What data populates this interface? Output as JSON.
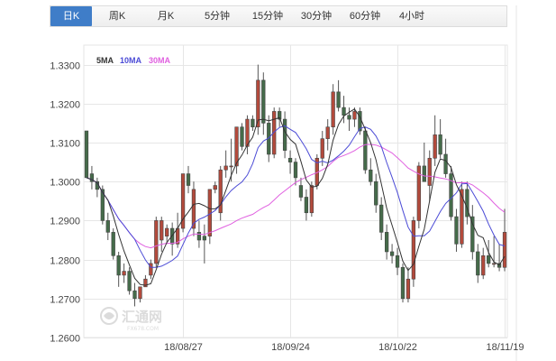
{
  "tabs": [
    {
      "label": "日K",
      "active": true
    },
    {
      "label": "周K",
      "active": false
    },
    {
      "label": "月K",
      "active": false
    },
    {
      "label": "5分钟",
      "active": false
    },
    {
      "label": "15分钟",
      "active": false
    },
    {
      "label": "30分钟",
      "active": false
    },
    {
      "label": "60分钟",
      "active": false
    },
    {
      "label": "4小时",
      "active": false
    }
  ],
  "colors": {
    "up": "#b34a3c",
    "down": "#456b4a",
    "ma5": "#333333",
    "ma10": "#4b4bd6",
    "ma30": "#e060e0",
    "grid": "#e6e6e6",
    "tab_active": "#3f7dc8"
  },
  "watermark": {
    "brand": "汇通网",
    "url": "FX678.COM",
    "icon": "huitong-logo-icon"
  },
  "chart_data": {
    "type": "candlestick",
    "title": "",
    "ylim": [
      1.26,
      1.335
    ],
    "y_ticks": [
      "1.3300",
      "1.3200",
      "1.3100",
      "1.3000",
      "1.2900",
      "1.2800",
      "1.2700",
      "1.2600"
    ],
    "x_ticks": [
      {
        "label": "18/08/27",
        "index": 18
      },
      {
        "label": "18/09/24",
        "index": 38
      },
      {
        "label": "18/10/22",
        "index": 58
      },
      {
        "label": "18/11/19",
        "index": 78
      }
    ],
    "legend": [
      {
        "label": "5MA",
        "color": "#333333"
      },
      {
        "label": "10MA",
        "color": "#4b4bd6"
      },
      {
        "label": "30MA",
        "color": "#e060e0"
      }
    ],
    "grid": true,
    "candles": [
      [
        1.313,
        1.3125,
        1.302,
        1.301
      ],
      [
        1.302,
        1.304,
        1.298,
        1.3
      ],
      [
        1.3,
        1.301,
        1.296,
        1.298
      ],
      [
        1.298,
        1.299,
        1.289,
        1.29
      ],
      [
        1.29,
        1.292,
        1.285,
        1.287
      ],
      [
        1.287,
        1.288,
        1.28,
        1.281
      ],
      [
        1.281,
        1.282,
        1.273,
        1.276
      ],
      [
        1.276,
        1.279,
        1.274,
        1.277
      ],
      [
        1.277,
        1.278,
        1.271,
        1.272
      ],
      [
        1.272,
        1.274,
        1.268,
        1.27
      ],
      [
        1.27,
        1.273,
        1.269,
        1.273
      ],
      [
        1.273,
        1.276,
        1.273,
        1.275
      ],
      [
        1.276,
        1.28,
        1.275,
        1.279
      ],
      [
        1.279,
        1.291,
        1.278,
        1.29
      ],
      [
        1.285,
        1.291,
        1.282,
        1.29
      ],
      [
        1.286,
        1.289,
        1.284,
        1.288
      ],
      [
        1.288,
        1.2895,
        1.281,
        1.284
      ],
      [
        1.284,
        1.292,
        1.283,
        1.288
      ],
      [
        1.288,
        1.302,
        1.287,
        1.302
      ],
      [
        1.302,
        1.304,
        1.297,
        1.299
      ],
      [
        1.288,
        1.3,
        1.286,
        1.298
      ],
      [
        1.287,
        1.29,
        1.283,
        1.285
      ],
      [
        1.286,
        1.289,
        1.279,
        1.285
      ],
      [
        1.286,
        1.298,
        1.284,
        1.298
      ],
      [
        1.298,
        1.3,
        1.297,
        1.299
      ],
      [
        1.292,
        1.304,
        1.29,
        1.303
      ],
      [
        1.303,
        1.308,
        1.301,
        1.304
      ],
      [
        1.304,
        1.311,
        1.3,
        1.304
      ],
      [
        1.304,
        1.314,
        1.302,
        1.314
      ],
      [
        1.314,
        1.315,
        1.308,
        1.309
      ],
      [
        1.309,
        1.317,
        1.307,
        1.316
      ],
      [
        1.316,
        1.317,
        1.313,
        1.314
      ],
      [
        1.314,
        1.33,
        1.312,
        1.326
      ],
      [
        1.326,
        1.328,
        1.312,
        1.315
      ],
      [
        1.315,
        1.317,
        1.305,
        1.307
      ],
      [
        1.307,
        1.319,
        1.306,
        1.318
      ],
      [
        1.318,
        1.319,
        1.314,
        1.316
      ],
      [
        1.316,
        1.318,
        1.306,
        1.308
      ],
      [
        1.306,
        1.308,
        1.302,
        1.305
      ],
      [
        1.305,
        1.306,
        1.299,
        1.301
      ],
      [
        1.299,
        1.301,
        1.295,
        1.296
      ],
      [
        1.296,
        1.298,
        1.29,
        1.292
      ],
      [
        1.292,
        1.3,
        1.291,
        1.299
      ],
      [
        1.299,
        1.307,
        1.298,
        1.306
      ],
      [
        1.306,
        1.313,
        1.304,
        1.311
      ],
      [
        1.311,
        1.316,
        1.308,
        1.314
      ],
      [
        1.314,
        1.325,
        1.312,
        1.323
      ],
      [
        1.323,
        1.326,
        1.318,
        1.319
      ],
      [
        1.319,
        1.322,
        1.315,
        1.317
      ],
      [
        1.317,
        1.319,
        1.313,
        1.316
      ],
      [
        1.316,
        1.319,
        1.314,
        1.318
      ],
      [
        1.318,
        1.319,
        1.312,
        1.313
      ],
      [
        1.313,
        1.314,
        1.302,
        1.303
      ],
      [
        1.303,
        1.306,
        1.299,
        1.3
      ],
      [
        1.3,
        1.302,
        1.292,
        1.294
      ],
      [
        1.294,
        1.296,
        1.285,
        1.287
      ],
      [
        1.287,
        1.289,
        1.28,
        1.282
      ],
      [
        1.282,
        1.284,
        1.279,
        1.281
      ],
      [
        1.281,
        1.283,
        1.276,
        1.278
      ],
      [
        1.278,
        1.279,
        1.269,
        1.27
      ],
      [
        1.27,
        1.278,
        1.269,
        1.275
      ],
      [
        1.275,
        1.291,
        1.273,
        1.29
      ],
      [
        1.29,
        1.305,
        1.288,
        1.304
      ],
      [
        1.304,
        1.31,
        1.3,
        1.3
      ],
      [
        1.299,
        1.308,
        1.295,
        1.306
      ],
      [
        1.306,
        1.317,
        1.304,
        1.312
      ],
      [
        1.312,
        1.316,
        1.306,
        1.307
      ],
      [
        1.307,
        1.311,
        1.301,
        1.302
      ],
      [
        1.302,
        1.304,
        1.29,
        1.291
      ],
      [
        1.291,
        1.293,
        1.282,
        1.284
      ],
      [
        1.284,
        1.3,
        1.283,
        1.298
      ],
      [
        1.298,
        1.3,
        1.289,
        1.291
      ],
      [
        1.291,
        1.294,
        1.28,
        1.282
      ],
      [
        1.282,
        1.284,
        1.274,
        1.276
      ],
      [
        1.276,
        1.283,
        1.275,
        1.281
      ],
      [
        1.281,
        1.285,
        1.278,
        1.279
      ],
      [
        1.279,
        1.286,
        1.278,
        1.279
      ],
      [
        1.279,
        1.284,
        1.277,
        1.278
      ],
      [
        1.278,
        1.293,
        1.277,
        1.287
      ]
    ]
  }
}
